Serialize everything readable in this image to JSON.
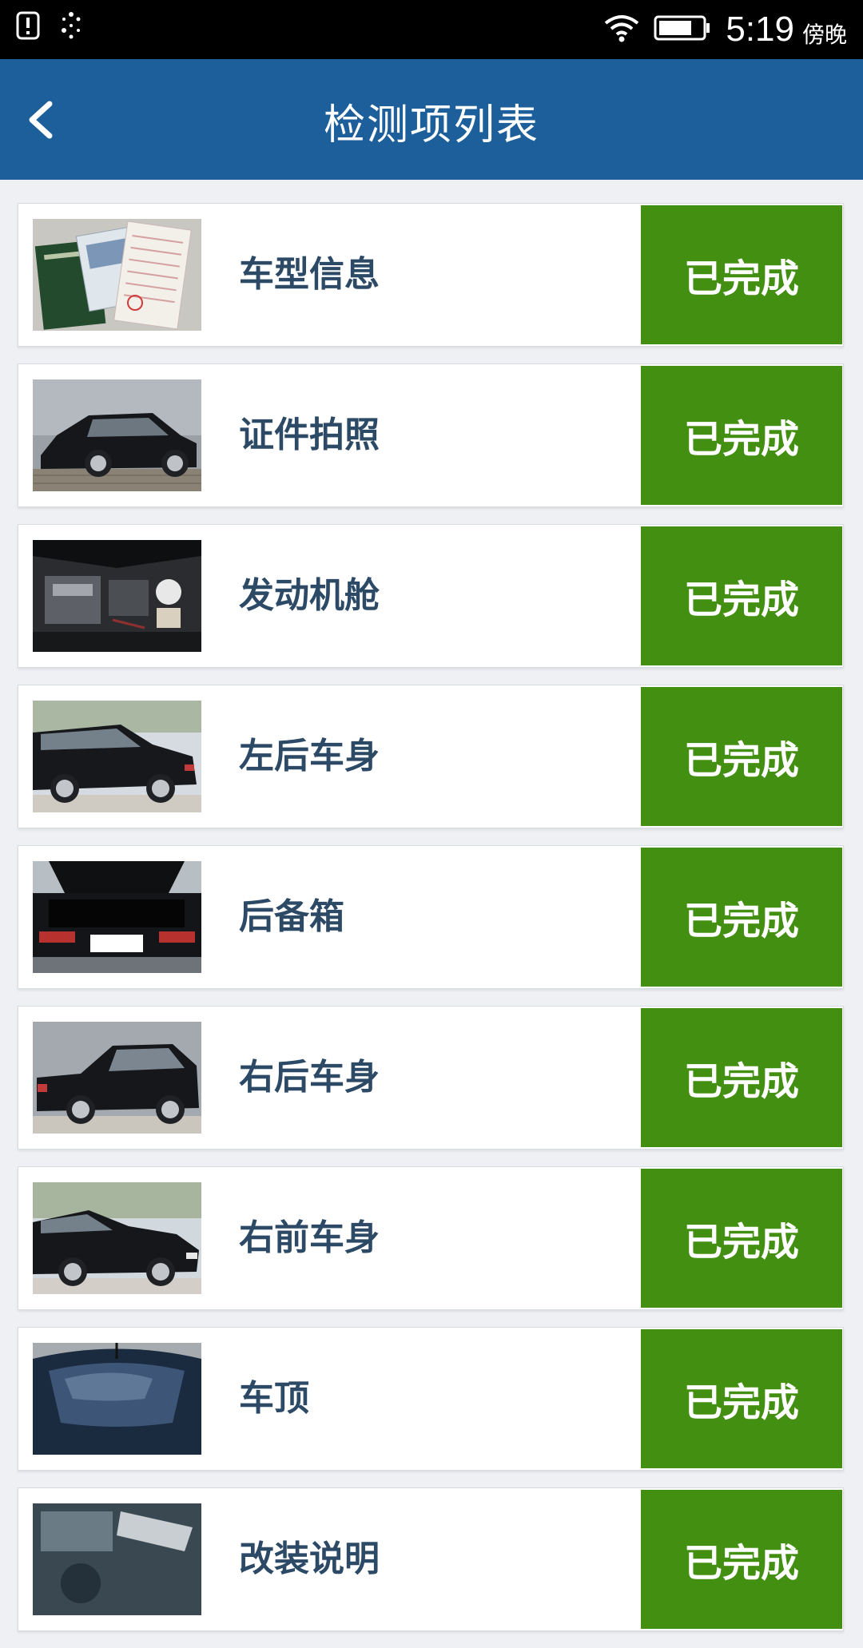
{
  "status_bar": {
    "time": "5:19",
    "period": "傍晚",
    "icons": [
      "alert-icon",
      "loading-icon",
      "wifi-icon",
      "battery-icon"
    ]
  },
  "header": {
    "title": "检测项列表",
    "back_icon": "chevron-left-icon"
  },
  "colors": {
    "header": "#1d5f9a",
    "status_done": "#438f12",
    "label_text": "#2c4a66"
  },
  "items": [
    {
      "label": "车型信息",
      "status": "已完成",
      "thumb": "documents"
    },
    {
      "label": "证件拍照",
      "status": "已完成",
      "thumb": "car-side"
    },
    {
      "label": "发动机舱",
      "status": "已完成",
      "thumb": "engine"
    },
    {
      "label": "左后车身",
      "status": "已完成",
      "thumb": "car-rear-left"
    },
    {
      "label": "后备箱",
      "status": "已完成",
      "thumb": "trunk"
    },
    {
      "label": "右后车身",
      "status": "已完成",
      "thumb": "car-rear-right"
    },
    {
      "label": "右前车身",
      "status": "已完成",
      "thumb": "car-front-right"
    },
    {
      "label": "车顶",
      "status": "已完成",
      "thumb": "roof"
    },
    {
      "label": "改装说明",
      "status": "已完成",
      "thumb": "modification"
    }
  ]
}
